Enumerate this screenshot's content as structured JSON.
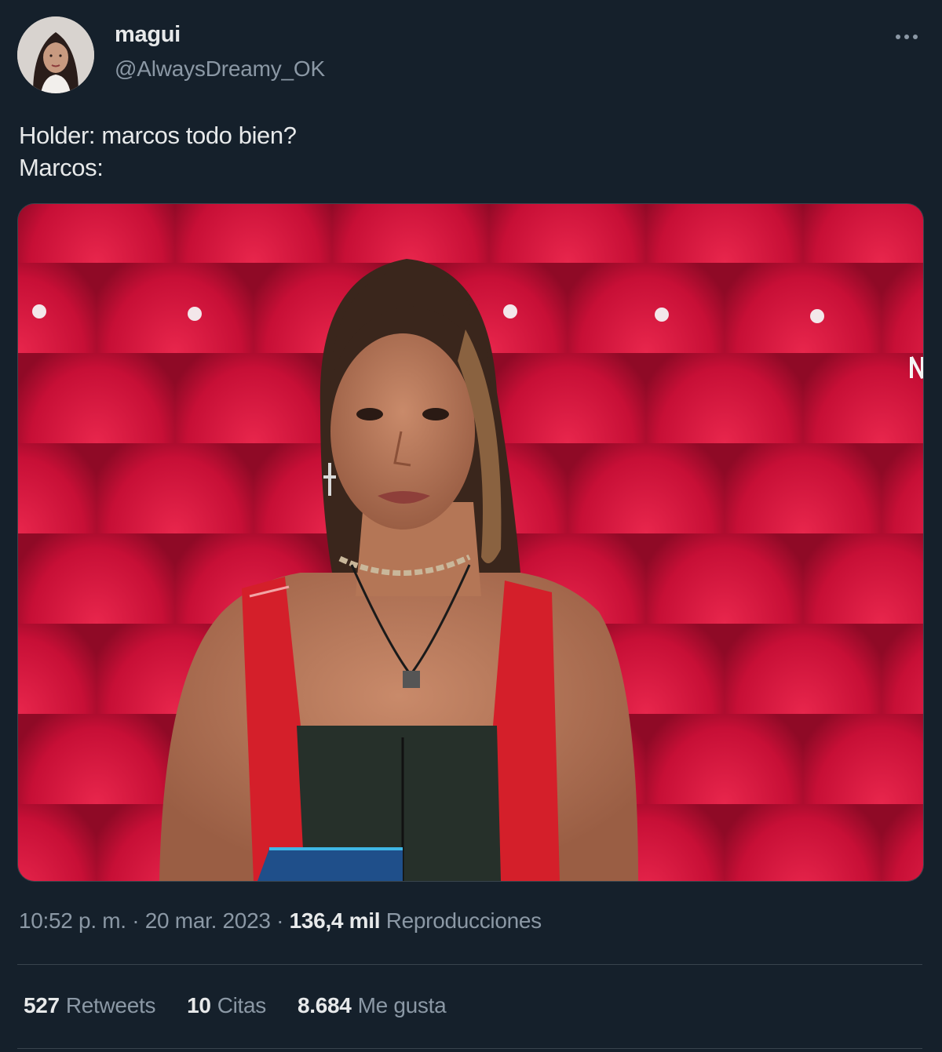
{
  "author": {
    "display_name": "magui",
    "handle": "@AlwaysDreamy_OK"
  },
  "tweet": {
    "lines": [
      "Holder: marcos todo bien?",
      "Marcos:"
    ]
  },
  "meta": {
    "time": "10:52 p. m.",
    "sep1": " · ",
    "date": "20 mar. 2023",
    "sep2": " · ",
    "views_count": "136,4 mil",
    "views_label": " Reproducciones"
  },
  "stats": {
    "retweets_count": "527",
    "retweets_label": "Retweets",
    "quotes_count": "10",
    "quotes_label": "Citas",
    "likes_count": "8.684",
    "likes_label": "Me gusta"
  },
  "icons": {
    "more": "more-options-icon"
  },
  "colors": {
    "background": "#15202b",
    "text_primary": "#e7e9ea",
    "text_secondary": "#8b98a5",
    "divider": "#38444d",
    "media_background": "#d0153c"
  }
}
